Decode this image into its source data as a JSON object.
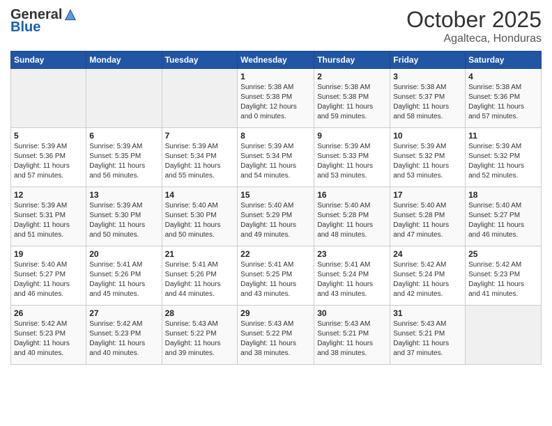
{
  "header": {
    "logo_general": "General",
    "logo_blue": "Blue",
    "month_title": "October 2025",
    "subtitle": "Agalteca, Honduras"
  },
  "days_of_week": [
    "Sunday",
    "Monday",
    "Tuesday",
    "Wednesday",
    "Thursday",
    "Friday",
    "Saturday"
  ],
  "weeks": [
    [
      {
        "day": "",
        "info": ""
      },
      {
        "day": "",
        "info": ""
      },
      {
        "day": "",
        "info": ""
      },
      {
        "day": "1",
        "info": "Sunrise: 5:38 AM\nSunset: 5:38 PM\nDaylight: 12 hours\nand 0 minutes."
      },
      {
        "day": "2",
        "info": "Sunrise: 5:38 AM\nSunset: 5:38 PM\nDaylight: 11 hours\nand 59 minutes."
      },
      {
        "day": "3",
        "info": "Sunrise: 5:38 AM\nSunset: 5:37 PM\nDaylight: 11 hours\nand 58 minutes."
      },
      {
        "day": "4",
        "info": "Sunrise: 5:38 AM\nSunset: 5:36 PM\nDaylight: 11 hours\nand 57 minutes."
      }
    ],
    [
      {
        "day": "5",
        "info": "Sunrise: 5:39 AM\nSunset: 5:36 PM\nDaylight: 11 hours\nand 57 minutes."
      },
      {
        "day": "6",
        "info": "Sunrise: 5:39 AM\nSunset: 5:35 PM\nDaylight: 11 hours\nand 56 minutes."
      },
      {
        "day": "7",
        "info": "Sunrise: 5:39 AM\nSunset: 5:34 PM\nDaylight: 11 hours\nand 55 minutes."
      },
      {
        "day": "8",
        "info": "Sunrise: 5:39 AM\nSunset: 5:34 PM\nDaylight: 11 hours\nand 54 minutes."
      },
      {
        "day": "9",
        "info": "Sunrise: 5:39 AM\nSunset: 5:33 PM\nDaylight: 11 hours\nand 53 minutes."
      },
      {
        "day": "10",
        "info": "Sunrise: 5:39 AM\nSunset: 5:32 PM\nDaylight: 11 hours\nand 53 minutes."
      },
      {
        "day": "11",
        "info": "Sunrise: 5:39 AM\nSunset: 5:32 PM\nDaylight: 11 hours\nand 52 minutes."
      }
    ],
    [
      {
        "day": "12",
        "info": "Sunrise: 5:39 AM\nSunset: 5:31 PM\nDaylight: 11 hours\nand 51 minutes."
      },
      {
        "day": "13",
        "info": "Sunrise: 5:39 AM\nSunset: 5:30 PM\nDaylight: 11 hours\nand 50 minutes."
      },
      {
        "day": "14",
        "info": "Sunrise: 5:40 AM\nSunset: 5:30 PM\nDaylight: 11 hours\nand 50 minutes."
      },
      {
        "day": "15",
        "info": "Sunrise: 5:40 AM\nSunset: 5:29 PM\nDaylight: 11 hours\nand 49 minutes."
      },
      {
        "day": "16",
        "info": "Sunrise: 5:40 AM\nSunset: 5:28 PM\nDaylight: 11 hours\nand 48 minutes."
      },
      {
        "day": "17",
        "info": "Sunrise: 5:40 AM\nSunset: 5:28 PM\nDaylight: 11 hours\nand 47 minutes."
      },
      {
        "day": "18",
        "info": "Sunrise: 5:40 AM\nSunset: 5:27 PM\nDaylight: 11 hours\nand 46 minutes."
      }
    ],
    [
      {
        "day": "19",
        "info": "Sunrise: 5:40 AM\nSunset: 5:27 PM\nDaylight: 11 hours\nand 46 minutes."
      },
      {
        "day": "20",
        "info": "Sunrise: 5:41 AM\nSunset: 5:26 PM\nDaylight: 11 hours\nand 45 minutes."
      },
      {
        "day": "21",
        "info": "Sunrise: 5:41 AM\nSunset: 5:26 PM\nDaylight: 11 hours\nand 44 minutes."
      },
      {
        "day": "22",
        "info": "Sunrise: 5:41 AM\nSunset: 5:25 PM\nDaylight: 11 hours\nand 43 minutes."
      },
      {
        "day": "23",
        "info": "Sunrise: 5:41 AM\nSunset: 5:24 PM\nDaylight: 11 hours\nand 43 minutes."
      },
      {
        "day": "24",
        "info": "Sunrise: 5:42 AM\nSunset: 5:24 PM\nDaylight: 11 hours\nand 42 minutes."
      },
      {
        "day": "25",
        "info": "Sunrise: 5:42 AM\nSunset: 5:23 PM\nDaylight: 11 hours\nand 41 minutes."
      }
    ],
    [
      {
        "day": "26",
        "info": "Sunrise: 5:42 AM\nSunset: 5:23 PM\nDaylight: 11 hours\nand 40 minutes."
      },
      {
        "day": "27",
        "info": "Sunrise: 5:42 AM\nSunset: 5:23 PM\nDaylight: 11 hours\nand 40 minutes."
      },
      {
        "day": "28",
        "info": "Sunrise: 5:43 AM\nSunset: 5:22 PM\nDaylight: 11 hours\nand 39 minutes."
      },
      {
        "day": "29",
        "info": "Sunrise: 5:43 AM\nSunset: 5:22 PM\nDaylight: 11 hours\nand 38 minutes."
      },
      {
        "day": "30",
        "info": "Sunrise: 5:43 AM\nSunset: 5:21 PM\nDaylight: 11 hours\nand 38 minutes."
      },
      {
        "day": "31",
        "info": "Sunrise: 5:43 AM\nSunset: 5:21 PM\nDaylight: 11 hours\nand 37 minutes."
      },
      {
        "day": "",
        "info": ""
      }
    ]
  ]
}
